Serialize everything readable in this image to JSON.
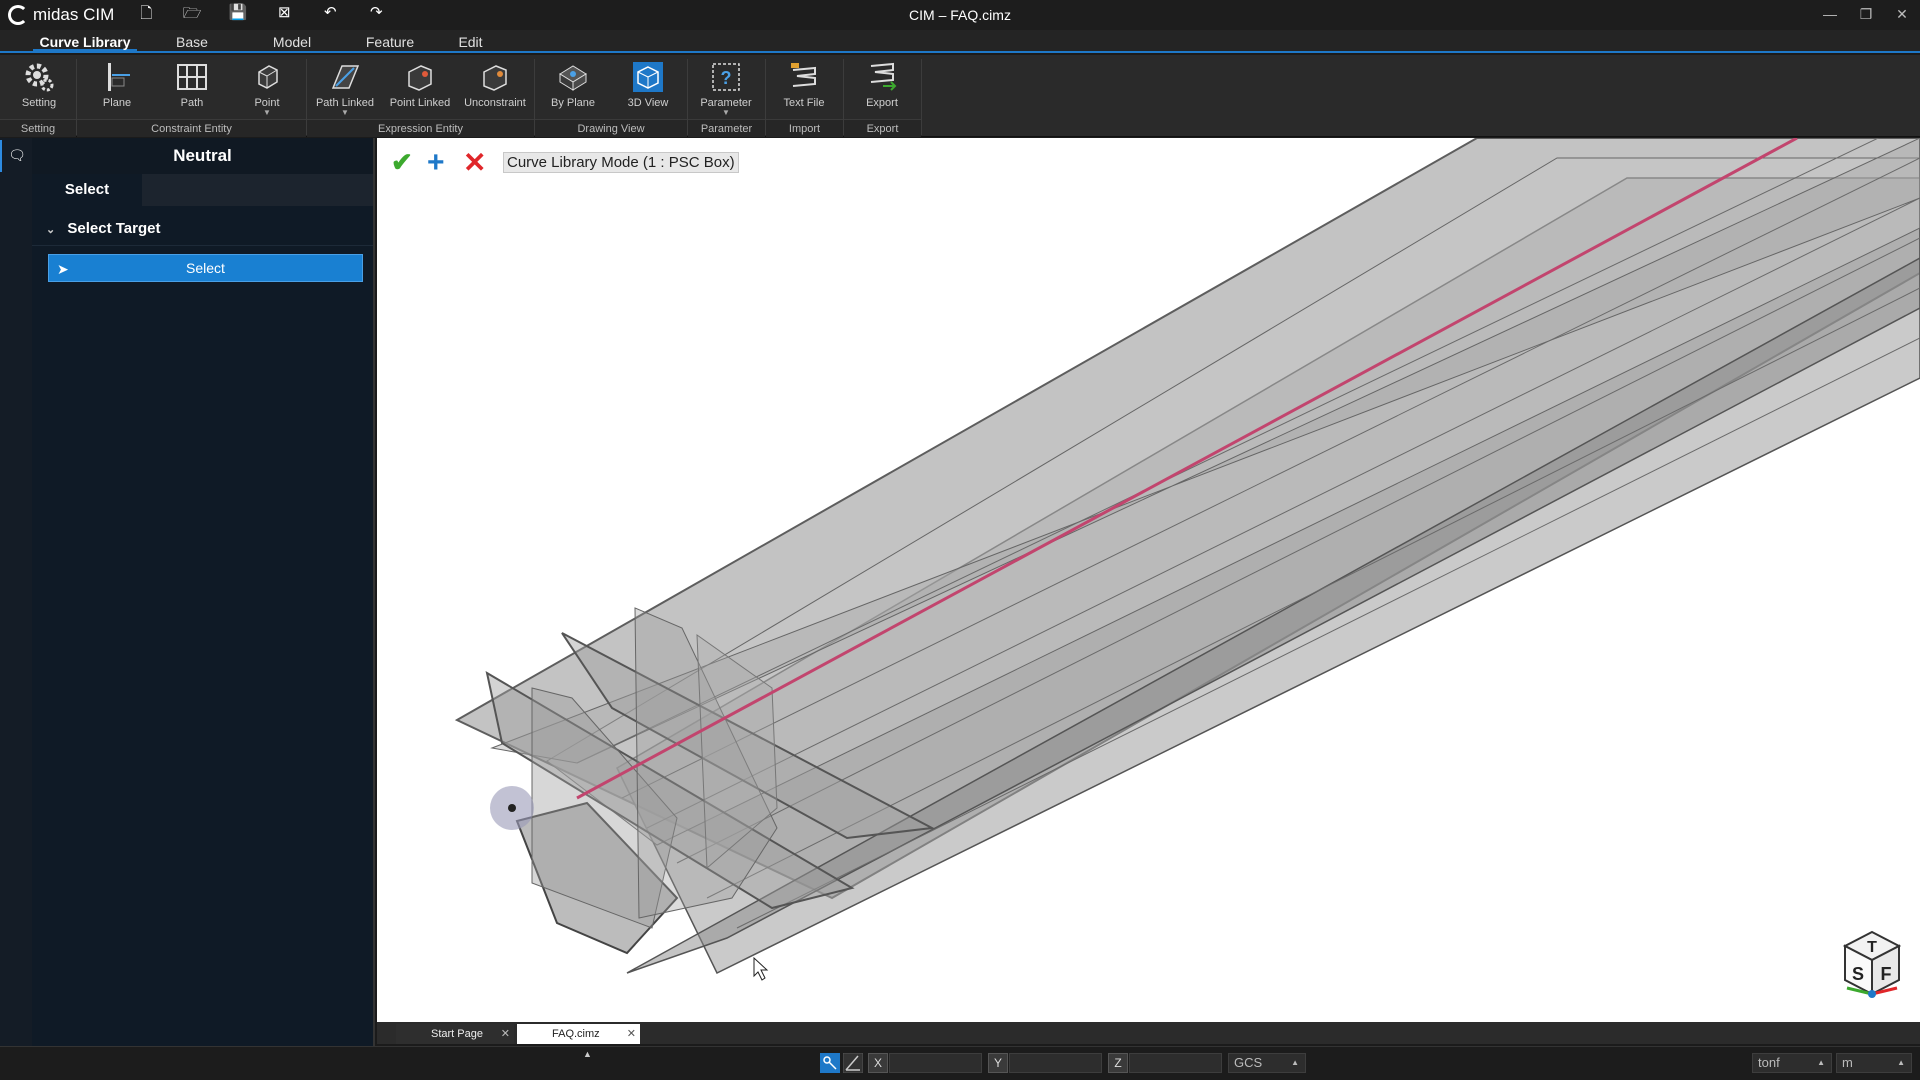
{
  "app": {
    "name": "midas CIM",
    "window_title": "CIM – FAQ.cimz"
  },
  "quick_access": [
    "new-file",
    "open-folder",
    "save",
    "close-file",
    "undo",
    "redo"
  ],
  "ribbon_tabs": [
    {
      "label": "Curve Library",
      "active": true
    },
    {
      "label": "Base"
    },
    {
      "label": "Model"
    },
    {
      "label": "Feature"
    },
    {
      "label": "Edit"
    }
  ],
  "ribbon": {
    "buttons": [
      {
        "label": "Setting"
      },
      {
        "label": "Plane"
      },
      {
        "label": "Path"
      },
      {
        "label": "Point"
      },
      {
        "label": "Path Linked"
      },
      {
        "label": "Point Linked"
      },
      {
        "label": "Unconstraint"
      },
      {
        "label": "By Plane"
      },
      {
        "label": "3D View"
      },
      {
        "label": "Parameter"
      },
      {
        "label": "Text File"
      },
      {
        "label": "Export"
      }
    ],
    "groups": [
      "Setting",
      "Constraint Entity",
      "Expression Entity",
      "Drawing View",
      "Parameter",
      "Import",
      "Export"
    ]
  },
  "panel": {
    "title": "Neutral",
    "tabs": [
      "Select"
    ],
    "section": "Select Target",
    "select_button": "Select"
  },
  "viewport": {
    "mode_label": "Curve Library Mode (1 : PSC Box)",
    "view_cube": {
      "top": "T",
      "left": "S",
      "right": "F"
    }
  },
  "doc_tabs": [
    {
      "label": "Start Page",
      "active": false
    },
    {
      "label": "FAQ.cimz",
      "active": true
    }
  ],
  "status": {
    "x_label": "X",
    "y_label": "Y",
    "z_label": "Z",
    "coord_system": "GCS",
    "force_unit": "tonf",
    "length_unit": "m"
  },
  "colors": {
    "accent": "#1e78c8",
    "ok": "#3ca92e",
    "cancel": "#e0262a",
    "path_line": "#c2456e"
  }
}
